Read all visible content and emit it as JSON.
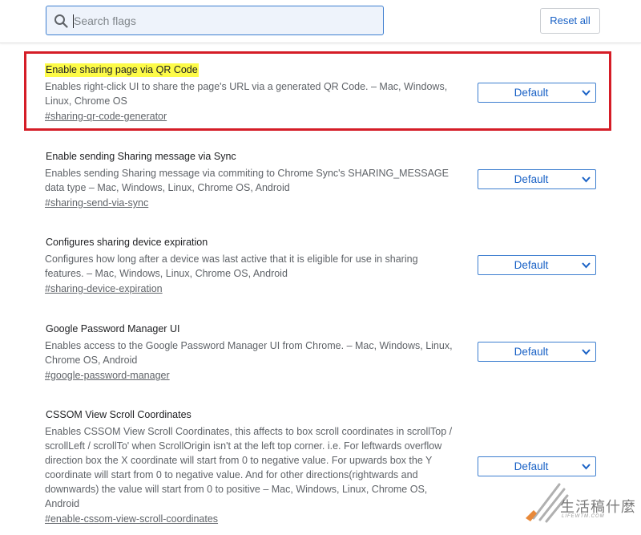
{
  "search": {
    "placeholder": "Search flags",
    "value": ""
  },
  "header": {
    "reset_label": "Reset all"
  },
  "experiments": [
    {
      "title": "Enable sharing page via QR Code",
      "description": "Enables right-click UI to share the page's URL via a generated QR Code. – Mac, Windows, Linux, Chrome OS",
      "link": "#sharing-qr-code-generator",
      "value": "Default"
    },
    {
      "title": "Enable sending Sharing message via Sync",
      "description": "Enables sending Sharing message via commiting to Chrome Sync's SHARING_MESSAGE data type – Mac, Windows, Linux, Chrome OS, Android",
      "link": "#sharing-send-via-sync",
      "value": "Default"
    },
    {
      "title": "Configures sharing device expiration",
      "description": "Configures how long after a device was last active that it is eligible for use in sharing features. – Mac, Windows, Linux, Chrome OS, Android",
      "link": "#sharing-device-expiration",
      "value": "Default"
    },
    {
      "title": "Google Password Manager UI",
      "description": "Enables access to the Google Password Manager UI from Chrome. – Mac, Windows, Linux, Chrome OS, Android",
      "link": "#google-password-manager",
      "value": "Default"
    },
    {
      "title": "CSSOM View Scroll Coordinates",
      "description": "Enables CSSOM View Scroll Coordinates, this affects to box scroll coordinates in scrollTop / scrollLeft / scrollTo' when ScrollOrigin isn't at the left top corner. i.e. For leftwards overflow direction box the X coordinate will start from 0 to negative value. For upwards box the Y coordinate will start from 0 to negative value. And for other directions(rightwards and downwards) the value will start from 0 to positive – Mac, Windows, Linux, Chrome OS, Android",
      "link": "#enable-cssom-view-scroll-coordinates",
      "value": "Default"
    }
  ],
  "watermark": {
    "text": "生活稿什麼",
    "sub": "LIFEWTM.COM"
  },
  "colors": {
    "accent": "#1a62c6",
    "highlight": "#fdfb48",
    "annotation_box": "#d51d27"
  }
}
